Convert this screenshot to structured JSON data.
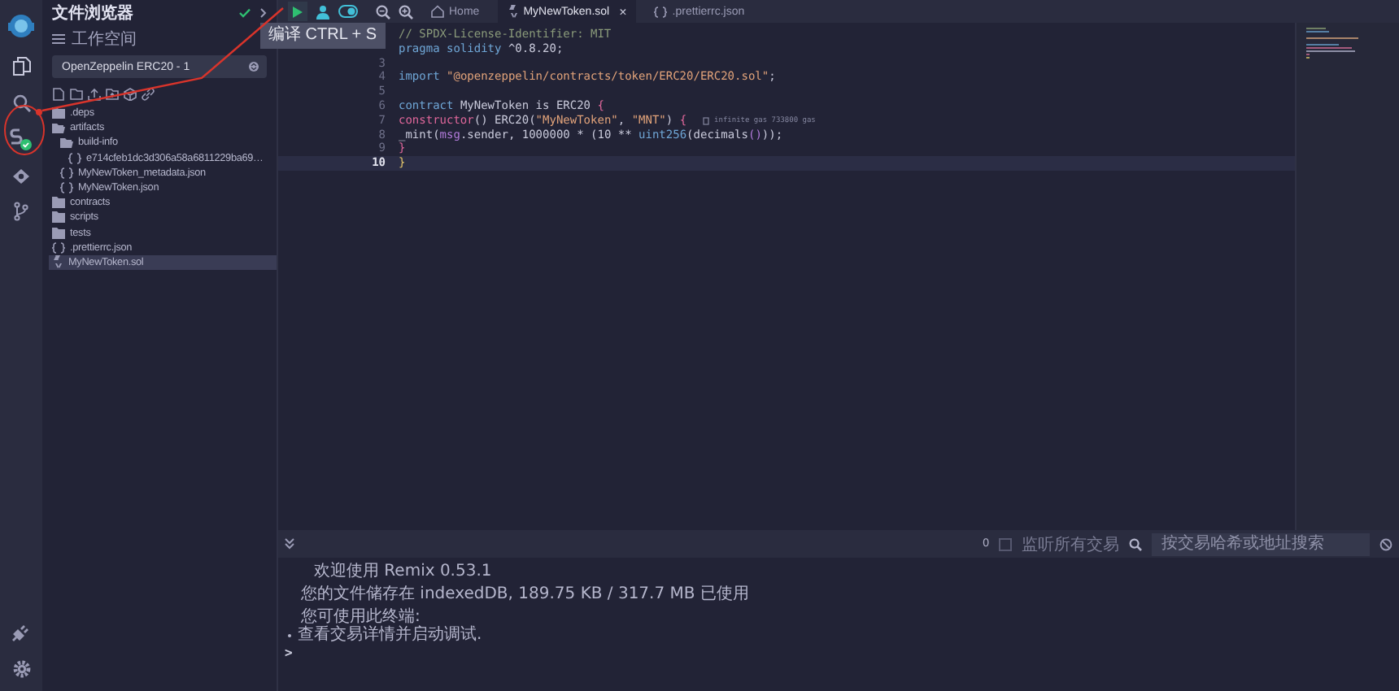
{
  "file_panel": {
    "title": "文件浏览器",
    "workspace_label": "工作空间",
    "workspace": "OpenZeppelin ERC20 - 1",
    "tree": [
      {
        "kind": "folder",
        "name": ".deps",
        "expanded": false,
        "selected": false
      },
      {
        "kind": "folder",
        "name": "artifacts",
        "expanded": true,
        "selected": false,
        "children": [
          {
            "kind": "folder",
            "name": "build-info",
            "expanded": true,
            "selected": false,
            "children": [
              {
                "kind": "json",
                "name": "e714cfeb1dc3d306a58a6811229ba69…",
                "selected": false
              }
            ]
          },
          {
            "kind": "json",
            "name": "MyNewToken_metadata.json",
            "selected": false
          },
          {
            "kind": "json",
            "name": "MyNewToken.json",
            "selected": false
          }
        ]
      },
      {
        "kind": "folder",
        "name": "contracts",
        "expanded": false,
        "selected": false
      },
      {
        "kind": "folder",
        "name": "scripts",
        "expanded": false,
        "selected": false
      },
      {
        "kind": "folder",
        "name": "tests",
        "expanded": false,
        "selected": false
      },
      {
        "kind": "json",
        "name": ".prettierrc.json",
        "selected": false
      },
      {
        "kind": "sol",
        "name": "MyNewToken.sol",
        "selected": true
      }
    ]
  },
  "tooltip": "编译 CTRL + S",
  "tabs": [
    {
      "kind": "home",
      "label": "Home",
      "selected": false
    },
    {
      "kind": "sol",
      "label": "MyNewToken.sol",
      "selected": true,
      "close": "×"
    },
    {
      "kind": "json",
      "label": ".prettierrc.json",
      "selected": false
    }
  ],
  "editor": {
    "lines": [
      {
        "tokens": [
          {
            "kind": "comment",
            "text": "// SPDX-License-Identifier: MIT"
          }
        ]
      },
      {
        "tokens": [
          {
            "kind": "keyword",
            "text": "pragma solidity "
          },
          {
            "kind": "plain",
            "text": "^0.8.20;"
          }
        ]
      },
      {
        "number": "3",
        "active": false
      },
      {
        "number": "4",
        "active": false,
        "tokens": [
          {
            "kind": "keyword",
            "text": "import "
          },
          {
            "kind": "string",
            "text": "\"@openzeppelin/contracts/token/ERC20/ERC20.sol\""
          },
          {
            "kind": "plain",
            "text": ";"
          }
        ]
      },
      {
        "number": "5",
        "active": false
      },
      {
        "number": "6",
        "active": false,
        "tokens": [
          {
            "kind": "keyword",
            "text": "contract "
          },
          {
            "kind": "plain",
            "text": "MyNewToken is ERC20 "
          },
          {
            "kind": "brace",
            "text": "{"
          }
        ]
      },
      {
        "number": "7",
        "active": false,
        "tokens": [
          {
            "kind": "func",
            "text": "constructor"
          },
          {
            "kind": "plain",
            "text": "() ERC20("
          },
          {
            "kind": "string",
            "text": "\"MyNewToken\""
          },
          {
            "kind": "plain",
            "text": ", "
          },
          {
            "kind": "string",
            "text": "\"MNT\""
          },
          {
            "kind": "plain",
            "text": ") "
          },
          {
            "kind": "brace",
            "text": "{"
          }
        ],
        "hint": "infinite gas 733800 gas"
      },
      {
        "number": "8",
        "active": false,
        "tokens": [
          {
            "kind": "plain",
            "text": "_mint("
          },
          {
            "kind": "var",
            "text": "msg"
          },
          {
            "kind": "plain",
            "text": ".sender, 1000000 * (10 ** "
          },
          {
            "kind": "keyword",
            "text": "uint256"
          },
          {
            "kind": "plain",
            "text": "(decimals"
          },
          {
            "kind": "var",
            "text": "()"
          },
          {
            "kind": "plain",
            "text": "));"
          }
        ]
      },
      {
        "number": "9",
        "active": false,
        "tokens": [
          {
            "kind": "brace",
            "text": "}"
          }
        ]
      },
      {
        "number": "10",
        "active": true,
        "tokens": [
          {
            "kind": "brace2",
            "text": "}"
          }
        ]
      }
    ]
  },
  "terminal": {
    "count": "0",
    "listen_all": {
      "label": "监听所有交易",
      "checked": false
    },
    "search": {
      "placeholder": "按交易哈希或地址搜索"
    },
    "lines": [
      {
        "kind": "welcome",
        "text": "欢迎使用 Remix 0.53.1"
      },
      {
        "kind": "plain",
        "text": "您的文件储存在 indexedDB, 189.75 KB / 317.7 MB 已使用"
      },
      {
        "kind": "plain",
        "text": "您可使用此终端:"
      },
      {
        "kind": "bullet",
        "text": "查看交易详情并启动调试."
      }
    ],
    "prompt": ">"
  }
}
